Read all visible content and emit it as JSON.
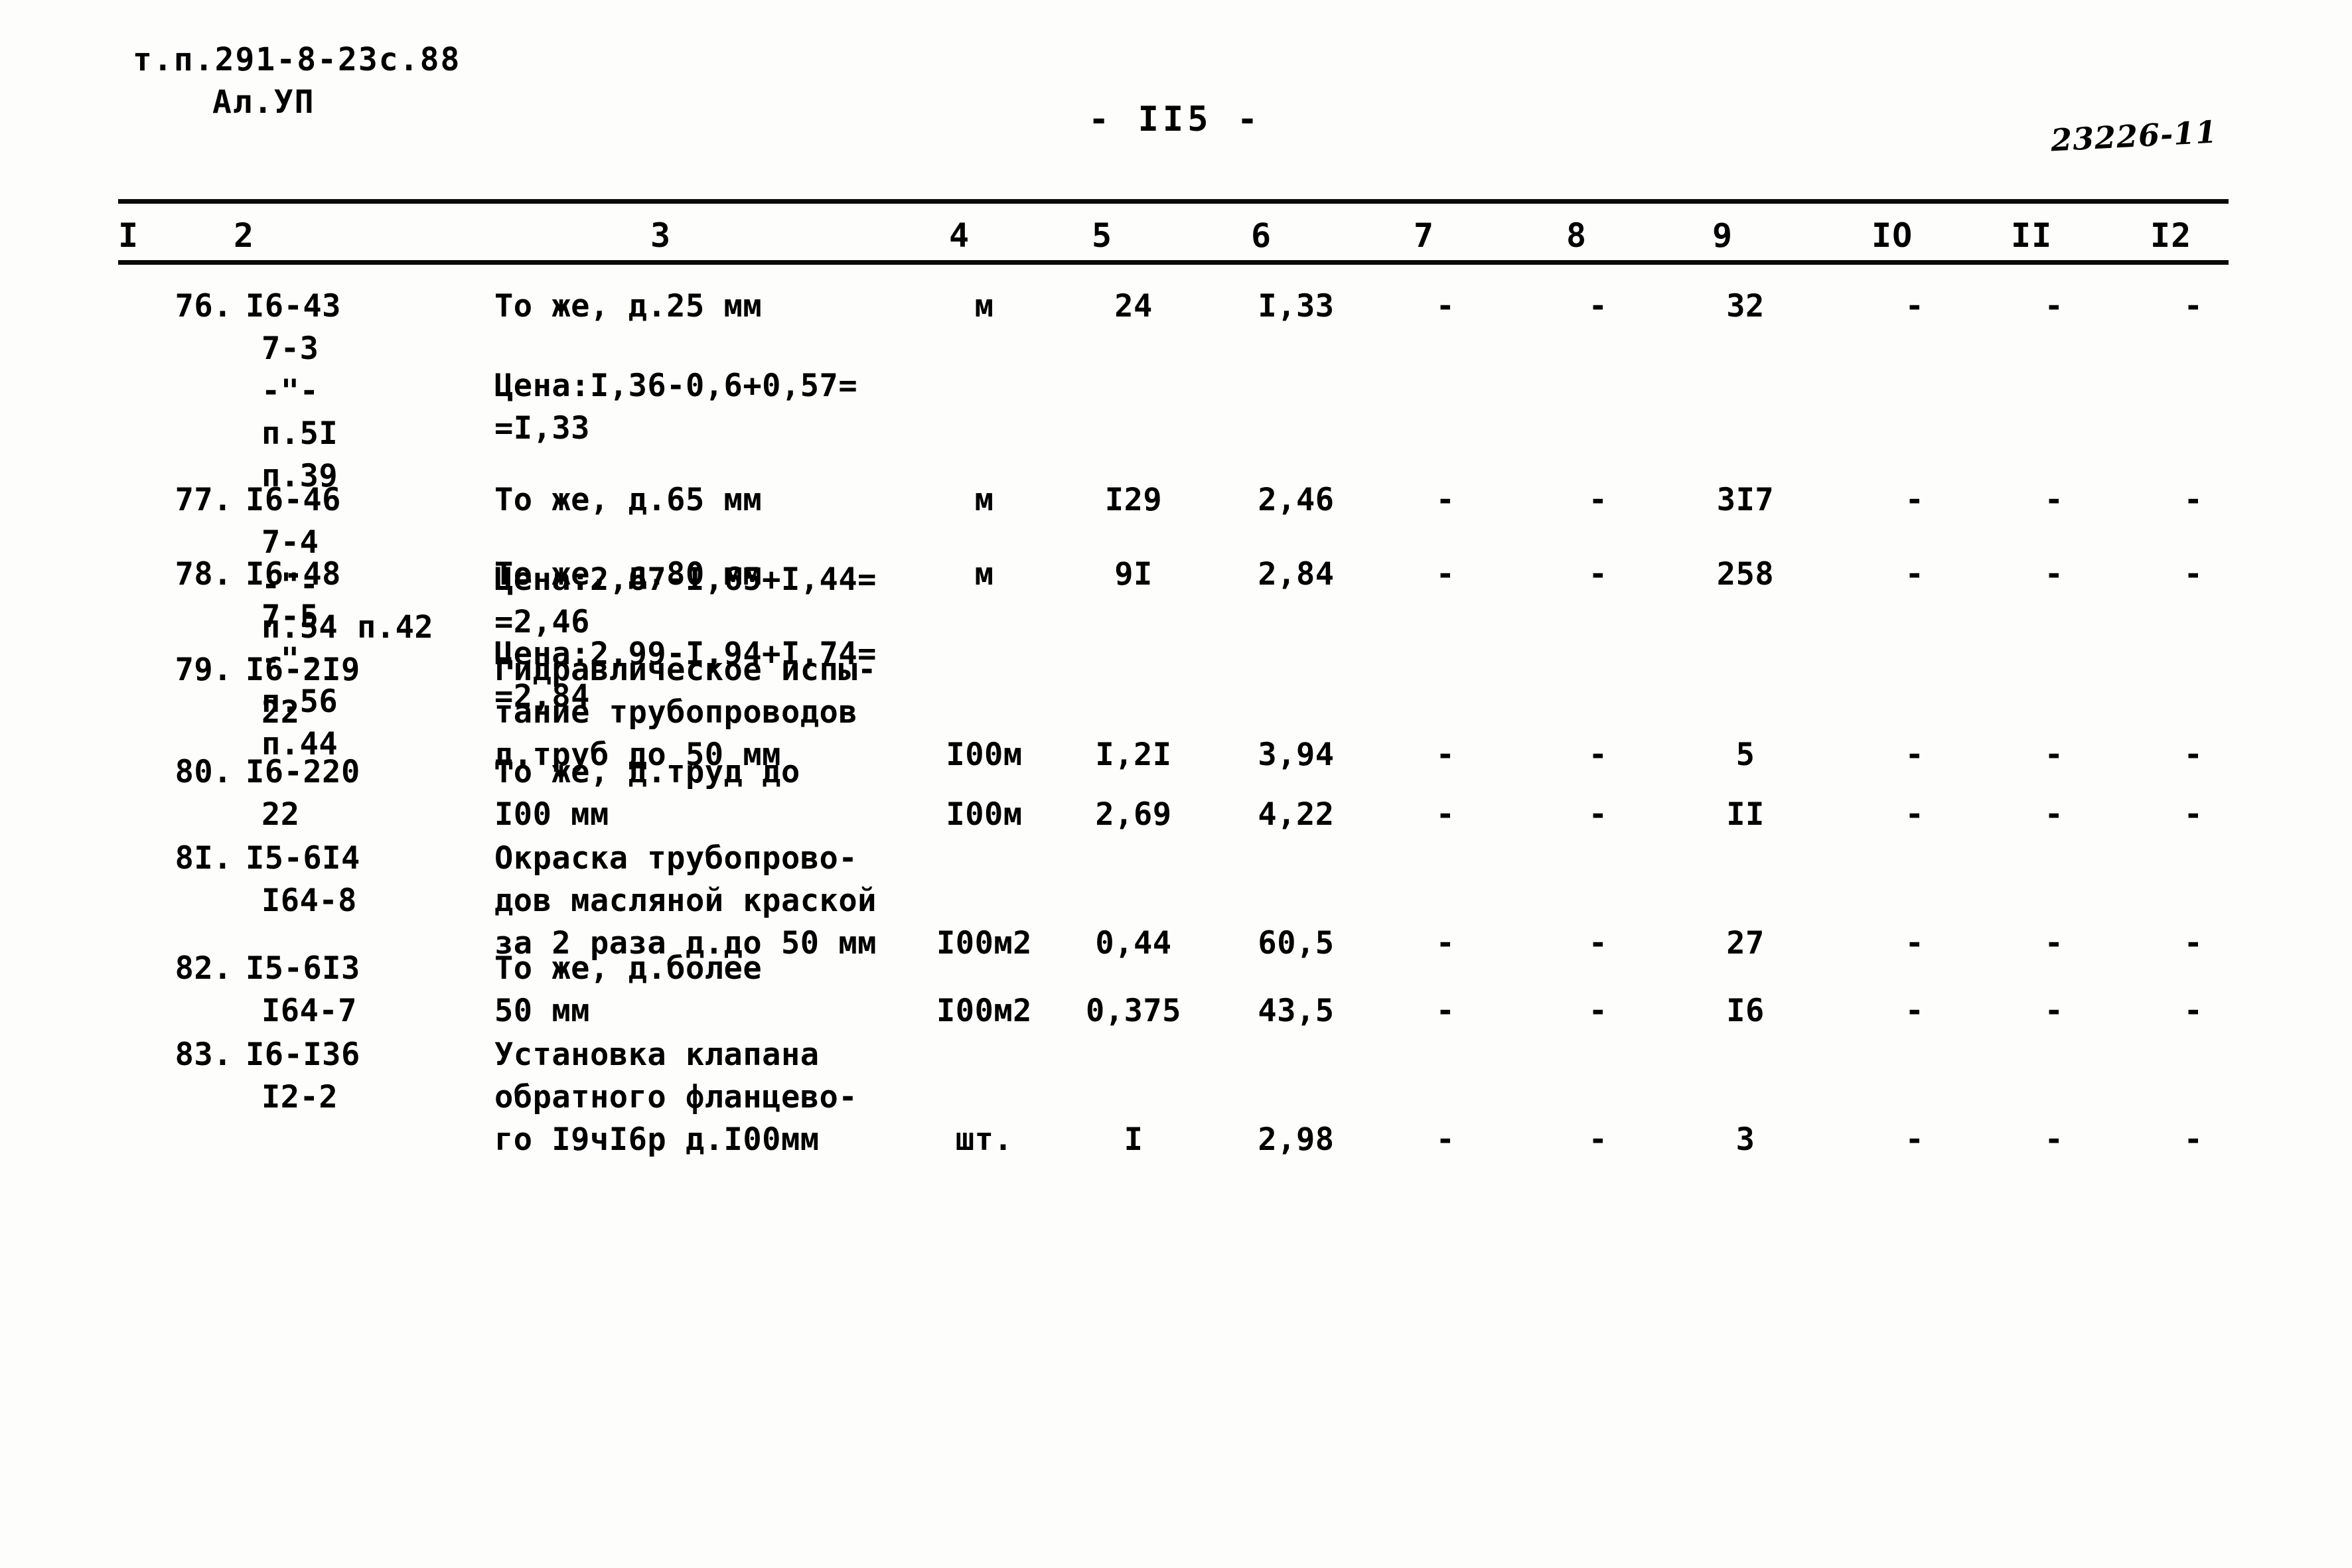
{
  "header": {
    "doc_code_line1": "т.п.291-8-23с.88",
    "doc_code_line2": "Ал.УП",
    "page_number": "- II5 -",
    "archive_number": "23226-11"
  },
  "table": {
    "column_headers": [
      "I",
      "2",
      "3",
      "4",
      "5",
      "6",
      "7",
      "8",
      "9",
      "IO",
      "II",
      "I2"
    ],
    "rows": [
      {
        "num": "76.",
        "code_lines": [
          "I6-43",
          "7-3",
          "-\"-",
          "п.5I",
          "п.39"
        ],
        "desc_lines": [
          "То же, д.25 мм"
        ],
        "price_calc_lines": [
          "Цена:I,36-0,6+0,57=",
          "=I,33"
        ],
        "unit": "м",
        "qty": "24",
        "price": "I,33",
        "c7": "-",
        "c8": "-",
        "c9": "32",
        "c10": "-",
        "c11": "-",
        "c12": "-"
      },
      {
        "num": "77.",
        "code_lines": [
          "I6-46",
          "7-4",
          "-\"-",
          "п.54 п.42"
        ],
        "desc_lines": [
          "То же, д.65 мм"
        ],
        "price_calc_lines": [
          "Цена:2,67-I,65+I,44=",
          "=2,46"
        ],
        "unit": "м",
        "qty": "I29",
        "price": "2,46",
        "c7": "-",
        "c8": "-",
        "c9": "3I7",
        "c10": "-",
        "c11": "-",
        "c12": "-"
      },
      {
        "num": "78.",
        "code_lines": [
          "I6-48",
          "7-5",
          "-\"-",
          "п.56",
          "п.44"
        ],
        "desc_lines": [
          "То же, д.80 мм"
        ],
        "price_calc_lines": [
          "Цена:2,99-I,94+I,74=",
          "=2,84"
        ],
        "unit": "м",
        "qty": "9I",
        "price": "2,84",
        "c7": "-",
        "c8": "-",
        "c9": "258",
        "c10": "-",
        "c11": "-",
        "c12": "-"
      },
      {
        "num": "79.",
        "code_lines": [
          "I6-2I9",
          "22"
        ],
        "desc_lines": [
          "Гидравлическое испы-",
          "тание трубопроводов",
          "д.труб до 50 мм"
        ],
        "price_calc_lines": [],
        "unit": "I00м",
        "qty": "I,2I",
        "price": "3,94",
        "c7": "-",
        "c8": "-",
        "c9": "5",
        "c10": "-",
        "c11": "-",
        "c12": "-"
      },
      {
        "num": "80.",
        "code_lines": [
          "I6-220",
          "22"
        ],
        "desc_lines": [
          "То же, д.труд до",
          "I00 мм"
        ],
        "price_calc_lines": [],
        "unit": "I00м",
        "qty": "2,69",
        "price": "4,22",
        "c7": "-",
        "c8": "-",
        "c9": "II",
        "c10": "-",
        "c11": "-",
        "c12": "-"
      },
      {
        "num": "8I.",
        "code_lines": [
          "I5-6I4",
          "I64-8"
        ],
        "desc_lines": [
          "Окраска трубопрово-",
          "дов масляной краской",
          "за 2 раза д.до 50 мм"
        ],
        "price_calc_lines": [],
        "unit": "I00м2",
        "qty": "0,44",
        "price": "60,5",
        "c7": "-",
        "c8": "-",
        "c9": "27",
        "c10": "-",
        "c11": "-",
        "c12": "-"
      },
      {
        "num": "82.",
        "code_lines": [
          "I5-6I3",
          "I64-7"
        ],
        "desc_lines": [
          "То же, д.более",
          "50 мм"
        ],
        "price_calc_lines": [],
        "unit": "I00м2",
        "qty": "0,375",
        "price": "43,5",
        "c7": "-",
        "c8": "-",
        "c9": "I6",
        "c10": "-",
        "c11": "-",
        "c12": "-"
      },
      {
        "num": "83.",
        "code_lines": [
          "I6-I36",
          "I2-2"
        ],
        "desc_lines": [
          "Установка клапана",
          "обратного фланцево-",
          "го I9чI6р д.I00мм"
        ],
        "price_calc_lines": [],
        "unit": "шт.",
        "qty": "I",
        "price": "2,98",
        "c7": "-",
        "c8": "-",
        "c9": "3",
        "c10": "-",
        "c11": "-",
        "c12": "-"
      }
    ]
  }
}
